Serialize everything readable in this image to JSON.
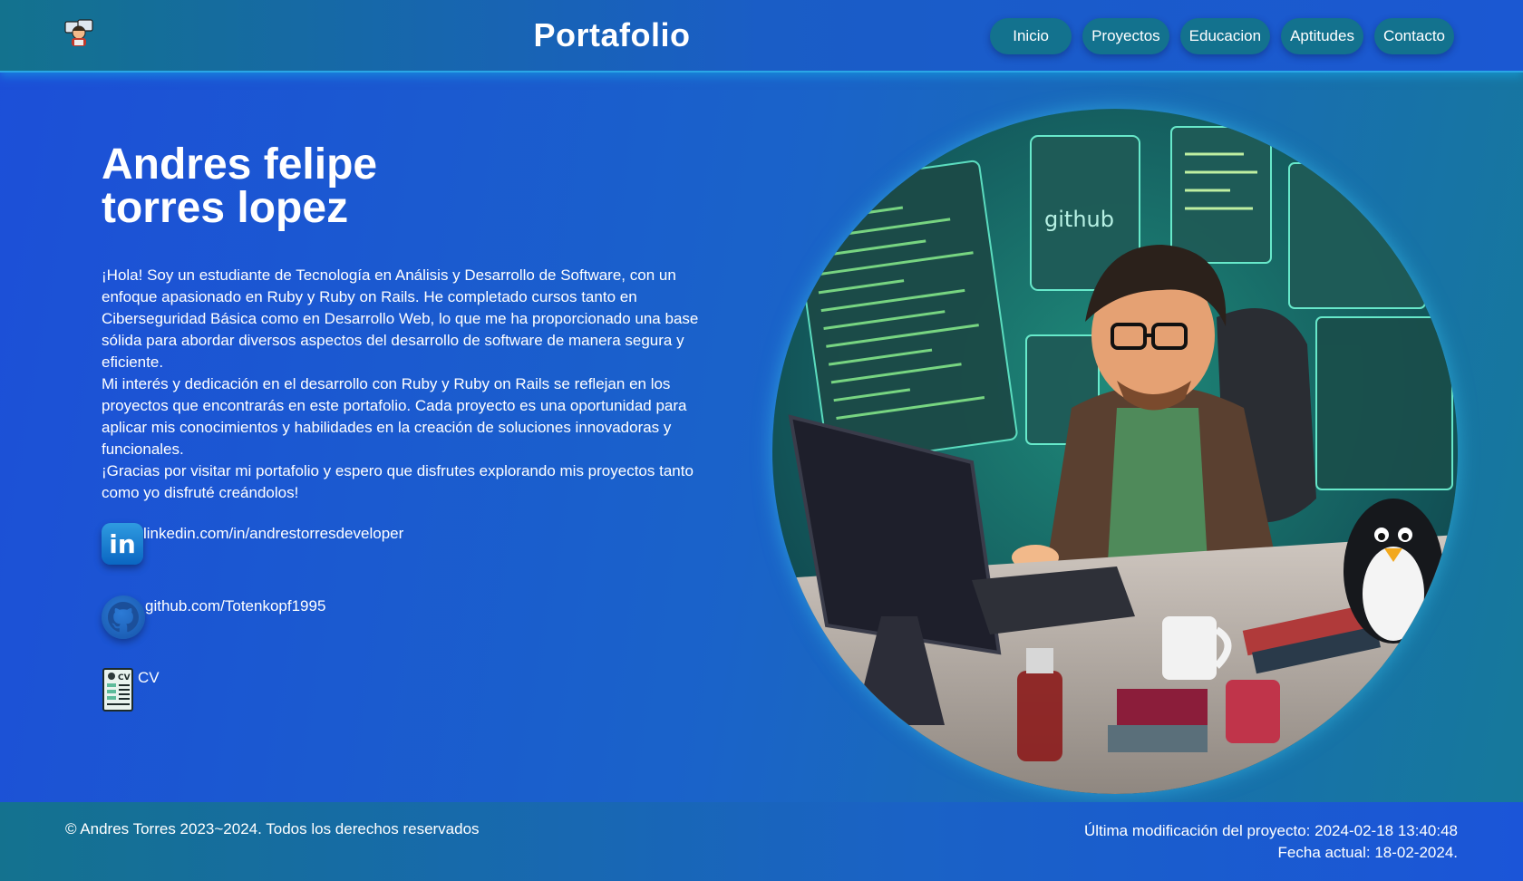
{
  "header": {
    "logo_icon": "developer-avatar-icon",
    "title": "Portafolio",
    "nav": [
      {
        "label": "Inicio"
      },
      {
        "label": "Proyectos"
      },
      {
        "label": "Educacion"
      },
      {
        "label": "Aptitudes"
      },
      {
        "label": "Contacto"
      }
    ]
  },
  "main": {
    "name_line1": "Andres felipe",
    "name_line2": "torres lopez",
    "bio": [
      "¡Hola! Soy un estudiante de Tecnología en Análisis y Desarrollo de Software, con un enfoque apasionado en Ruby y Ruby on Rails. He completado cursos tanto en Ciberseguridad Básica como en Desarrollo Web, lo que me ha proporcionado una base sólida para abordar diversos aspectos del desarrollo de software de manera segura y eficiente.",
      "Mi interés y dedicación en el desarrollo con Ruby y Ruby on Rails se reflejan en los proyectos que encontrarás en este portafolio. Cada proyecto es una oportunidad para aplicar mis conocimientos y habilidades en la creación de soluciones innovadoras y funcionales.",
      "¡Gracias por visitar mi portafolio y espero que disfrutes explorando mis proyectos tanto como yo disfruté creándolos!"
    ],
    "links": {
      "linkedin": {
        "label": "linkedin.com/in/andrestorresdeveloper",
        "icon": "linkedin-icon",
        "icon_text": "in"
      },
      "github": {
        "label": "github.com/Totenkopf1995",
        "icon": "github-icon"
      },
      "cv": {
        "label": "CV",
        "icon": "cv-document-icon",
        "icon_text": "CV"
      }
    },
    "hero_image": {
      "subject": "illustrated developer coding at a desk with monitors, a penguin and a mug",
      "screen_text": "github"
    }
  },
  "footer": {
    "copyright": "© Andres Torres 2023~2024. Todos los derechos reservados",
    "last_modified": "Última modificación del proyecto: 2024-02-18 13:40:48",
    "current_date": "Fecha actual: 18-02-2024."
  },
  "colors": {
    "background": "#1c4fd8",
    "header_teal": "#13728e",
    "glow": "#2aa6e6"
  }
}
